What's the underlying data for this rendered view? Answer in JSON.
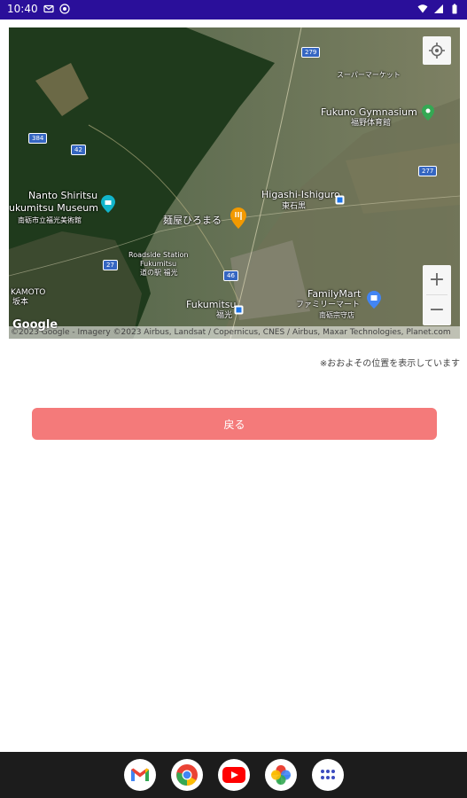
{
  "status_bar": {
    "time": "10:40",
    "left_icons": [
      "gmail-icon",
      "notification-icon"
    ],
    "right_icons": [
      "wifi-icon",
      "signal-icon",
      "battery-icon"
    ],
    "background_color": "#2a0f9a"
  },
  "map": {
    "labels": {
      "nanto_title": "Nanto Shiritsu",
      "nanto_museum": "ukumitsu Museum",
      "nanto_jp": "南砺市立福光美術館",
      "menya": "麺屋ひろまる",
      "higashi": "Higashi-Ishiguro",
      "higashi_jp": "東石黒",
      "fukuno": "Fukuno Gymnasium",
      "fukuno_jp": "福野体育館",
      "roadside1": "Roadside Station",
      "roadside2": "Fukumitsu",
      "roadside_jp": "道の駅 福光",
      "fukumitsu": "Fukumitsu",
      "fukumitsu_jp": "福光",
      "familymart": "FamilyMart",
      "familymart_jp": "ファミリーマート",
      "familymart_sub": "南砺宗守店",
      "kamoto": "KAMOTO",
      "kamoto_jp": "坂本",
      "supermarket": "スーパーマーケット"
    },
    "routes": [
      "279",
      "384",
      "42",
      "27",
      "46",
      "277"
    ],
    "google_logo": "Google",
    "attribution": "©2023 Google - Imagery ©2023 Airbus, Landsat / Copernicus, CNES / Airbus, Maxar Technologies, Planet.com",
    "zoom_in": "+",
    "zoom_out": "−"
  },
  "note": "※おおよその位置を表示しています",
  "back_button": {
    "label": "戻る",
    "color": "#f47a7a"
  },
  "dock": [
    "gmail-icon",
    "chrome-icon",
    "youtube-icon",
    "photos-icon",
    "app-drawer-icon"
  ]
}
